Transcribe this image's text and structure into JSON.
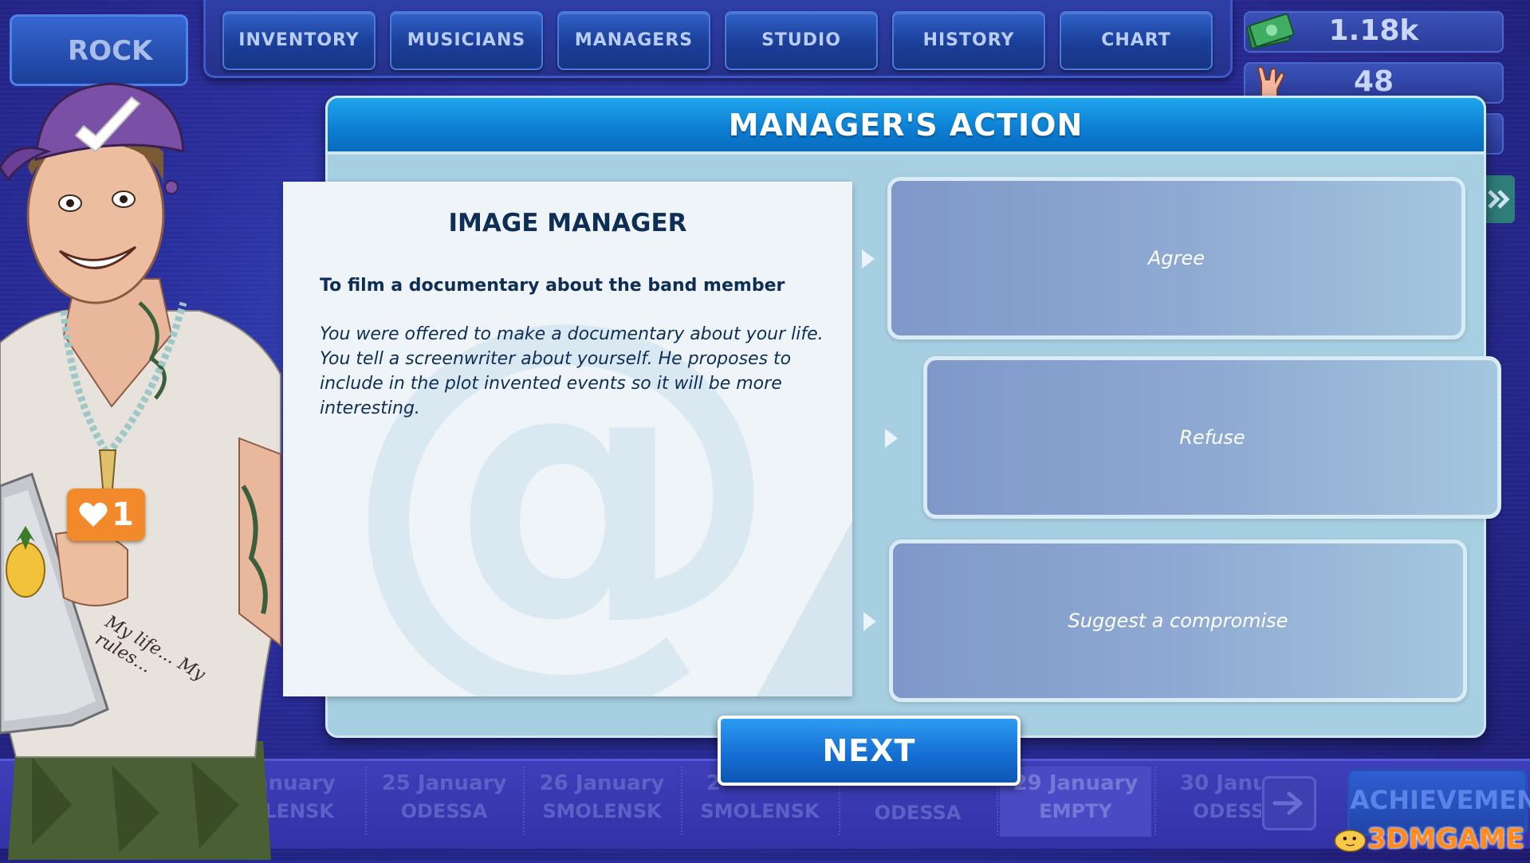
{
  "topbar": {
    "rock_label": "ROCK",
    "tabs": [
      {
        "label": "INVENTORY"
      },
      {
        "label": "MUSICIANS"
      },
      {
        "label": "MANAGERS"
      },
      {
        "label": "STUDIO"
      },
      {
        "label": "HISTORY"
      },
      {
        "label": "CHART"
      }
    ]
  },
  "resources": {
    "money": "1.18k",
    "fans": "48"
  },
  "dialog": {
    "header": "MANAGER'S ACTION",
    "card": {
      "title": "IMAGE MANAGER",
      "subtitle": "To film a documentary about the band member",
      "description": "You were offered to make a documentary about your life. You tell a screenwriter about yourself. He proposes to include in the plot invented events so it will be more interesting."
    },
    "options": [
      {
        "label": "Agree"
      },
      {
        "label": "Refuse"
      },
      {
        "label": "Suggest a compromise"
      }
    ],
    "next_label": "NEXT"
  },
  "character": {
    "like_count": "1",
    "tattoo_text": "My life... My rules..."
  },
  "calendar": {
    "days": [
      {
        "date": "January",
        "city": "OLENSK"
      },
      {
        "date": "25 January",
        "city": "ODESSA"
      },
      {
        "date": "26 January",
        "city": "SMOLENSK"
      },
      {
        "date": "2",
        "city": "SMOLENSK"
      },
      {
        "date": "",
        "city": "ODESSA"
      },
      {
        "date": "29 January",
        "city": "EMPTY"
      },
      {
        "date": "30 Janu",
        "city": "ODESS"
      }
    ],
    "achievements_label": "ACHIEVEMENTS"
  },
  "watermark": "3DMGAME",
  "colors": {
    "header_blue": "#0c7dd3",
    "panel": "#a7cfe2",
    "card": "#eef4f8",
    "text_dark": "#0f2e55",
    "option": "#8ea9d2"
  }
}
